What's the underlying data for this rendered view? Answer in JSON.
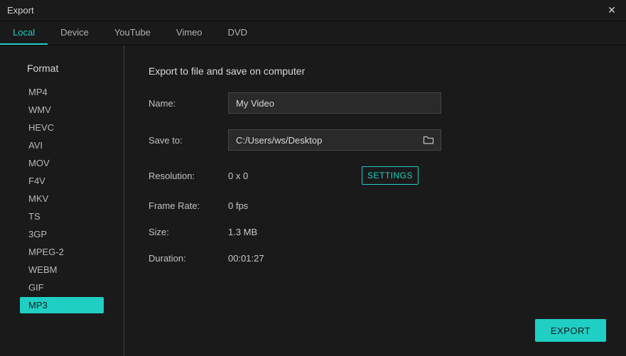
{
  "window": {
    "title": "Export"
  },
  "tabs": [
    {
      "label": "Local",
      "active": true
    },
    {
      "label": "Device",
      "active": false
    },
    {
      "label": "YouTube",
      "active": false
    },
    {
      "label": "Vimeo",
      "active": false
    },
    {
      "label": "DVD",
      "active": false
    }
  ],
  "sidebar": {
    "header": "Format",
    "formats": [
      {
        "label": "MP4",
        "selected": false
      },
      {
        "label": "WMV",
        "selected": false
      },
      {
        "label": "HEVC",
        "selected": false
      },
      {
        "label": "AVI",
        "selected": false
      },
      {
        "label": "MOV",
        "selected": false
      },
      {
        "label": "F4V",
        "selected": false
      },
      {
        "label": "MKV",
        "selected": false
      },
      {
        "label": "TS",
        "selected": false
      },
      {
        "label": "3GP",
        "selected": false
      },
      {
        "label": "MPEG-2",
        "selected": false
      },
      {
        "label": "WEBM",
        "selected": false
      },
      {
        "label": "GIF",
        "selected": false
      },
      {
        "label": "MP3",
        "selected": true
      }
    ]
  },
  "main": {
    "title": "Export to file and save on computer",
    "name_label": "Name:",
    "name_value": "My Video",
    "saveto_label": "Save to:",
    "saveto_value": "C:/Users/ws/Desktop",
    "resolution_label": "Resolution:",
    "resolution_value": "0 x 0",
    "settings_btn": "SETTINGS",
    "framerate_label": "Frame Rate:",
    "framerate_value": "0 fps",
    "size_label": "Size:",
    "size_value": "1.3 MB",
    "duration_label": "Duration:",
    "duration_value": "00:01:27"
  },
  "footer": {
    "export_btn": "EXPORT"
  }
}
